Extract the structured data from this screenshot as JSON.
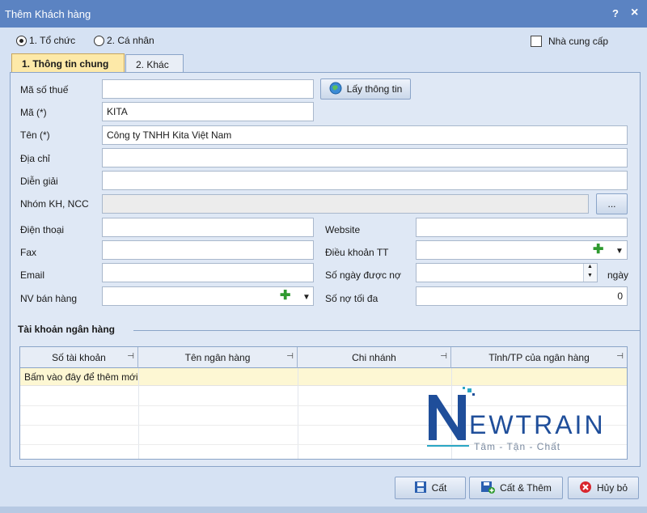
{
  "window": {
    "title": "Thêm Khách hàng",
    "help": "?",
    "close": "×"
  },
  "type_options": [
    {
      "label": "1. Tổ chức",
      "selected": true
    },
    {
      "label": "2. Cá nhân",
      "selected": false
    }
  ],
  "supplier_checkbox": {
    "label": "Nhà cung cấp",
    "checked": false
  },
  "tabs": [
    {
      "label": "1. Thông tin chung"
    },
    {
      "label": "2. Khác"
    }
  ],
  "form": {
    "tax_code_label": "Mã số thuế",
    "tax_code_value": "",
    "fetch_button": "Lấy thông tin",
    "code_label": "Mã (*)",
    "code_value": "KITA",
    "name_label": "Tên (*)",
    "name_value": "Công ty TNHH Kita Việt Nam",
    "address_label": "Địa chỉ",
    "address_value": "",
    "note_label": "Diễn giải",
    "note_value": "",
    "group_label": "Nhóm KH, NCC",
    "group_value": "",
    "group_button": "...",
    "phone_label": "Điện thoại",
    "phone_value": "",
    "fax_label": "Fax",
    "fax_value": "",
    "email_label": "Email",
    "email_value": "",
    "salesperson_label": "NV bán hàng",
    "salesperson_value": "",
    "website_label": "Website",
    "website_value": "",
    "terms_label": "Điều khoản TT",
    "terms_value": "",
    "days_label": "Số ngày được nợ",
    "days_value": "",
    "days_unit": "ngày",
    "max_debt_label": "Số nợ tối đa",
    "max_debt_value": "0"
  },
  "bank": {
    "section_title": "Tài khoản ngân hàng",
    "columns": [
      "Số tài khoản",
      "Tên ngân hàng",
      "Chi nhánh",
      "Tỉnh/TP của ngân hàng"
    ],
    "new_row_hint": "Bấm vào đây để thêm mới"
  },
  "watermark": {
    "brand": "NEWTRAIN",
    "tagline": "Tâm - Tận - Chất"
  },
  "footer": {
    "save": "Cất",
    "save_add": "Cất & Thêm",
    "cancel": "Hủy bỏ"
  },
  "colors": {
    "titlebar": "#5b83c2",
    "active_tab": "#fde9a8",
    "brand_blue": "#1f4e9a",
    "brand_teal": "#2aa6c4"
  }
}
